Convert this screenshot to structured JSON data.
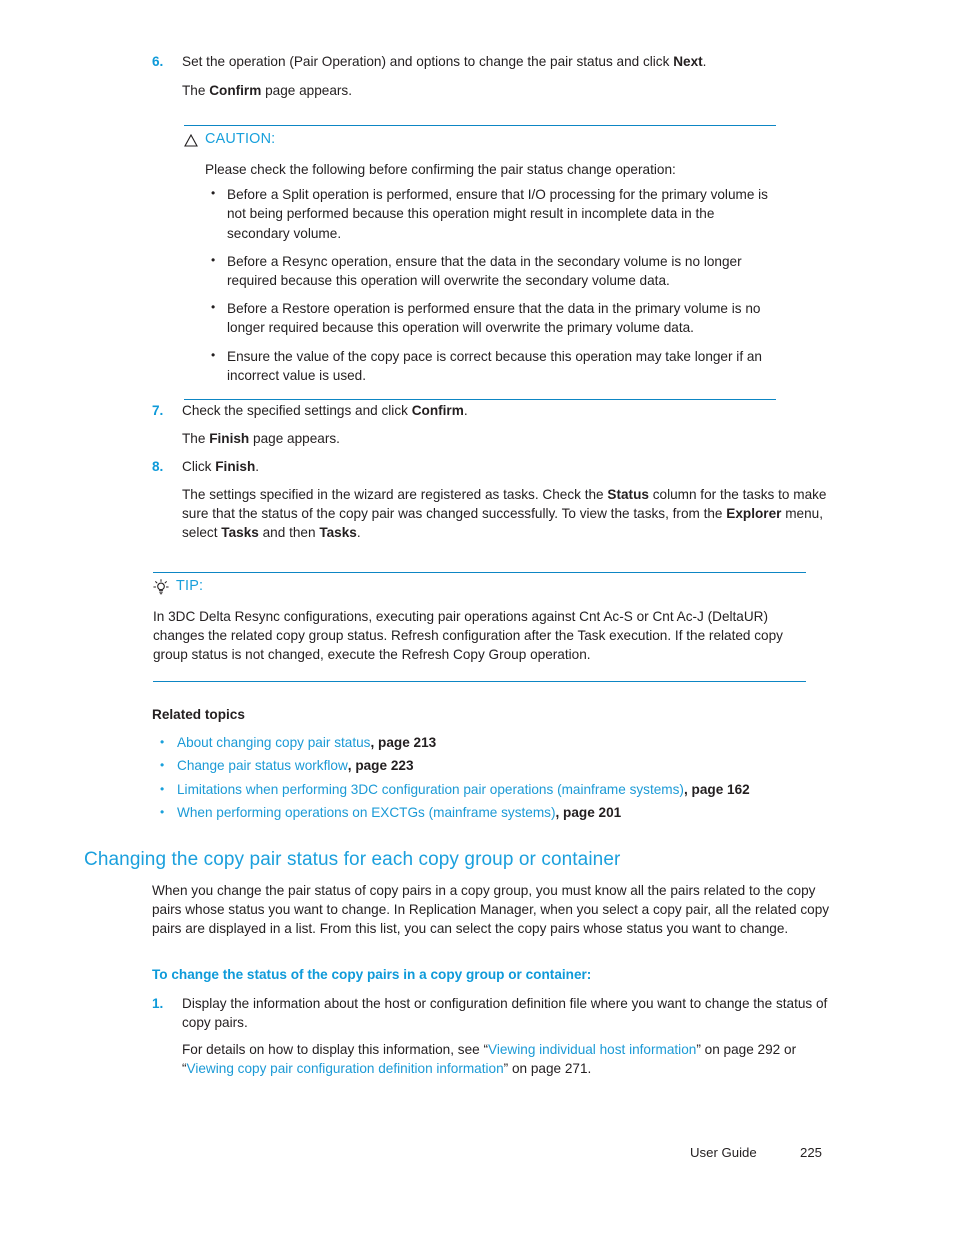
{
  "page": {
    "number": "225",
    "footer_label": "User Guide"
  },
  "colors": {
    "accent_blue": "#19a0db",
    "rule_blue": "#0d86c4",
    "link_blue": "#1b9ad6",
    "heading_blue": "#1ba0dd",
    "body_black": "#231f20"
  },
  "steps": {
    "step6": {
      "number": "6.",
      "text_pre": "Set the operation (Pair Operation) and options to change the pair status and click ",
      "bold1": "Next",
      "text_post": ".",
      "followup_pre": "The ",
      "followup_bold": "Confirm",
      "followup_post": " page appears."
    },
    "step7": {
      "number": "7.",
      "text_pre": "Check the specified settings and click ",
      "bold1": "Confirm",
      "text_post": ".",
      "followup_pre": "The ",
      "followup_bold": "Finish",
      "followup_post": " page appears."
    },
    "step8": {
      "number": "8.",
      "text_pre": "Click ",
      "bold1": "Finish",
      "text_post": ".",
      "para_1": "The settings specified in the wizard are registered as tasks. Check the ",
      "para_b1": "Status",
      "para_2": " column for the tasks to make sure that the status of the copy pair was changed successfully. To view the tasks, from the ",
      "para_b2": "Explorer",
      "para_3": " menu, select ",
      "para_b3": "Tasks",
      "para_4": " and then ",
      "para_b4": "Tasks",
      "para_5": "."
    }
  },
  "caution": {
    "icon": "warning-triangle-icon",
    "label": "CAUTION:",
    "intro": "Please check the following before confirming the pair status change operation:",
    "bullets": [
      "Before a Split operation is performed, ensure that I/O processing for the primary volume is not being performed because this operation might result in incomplete data in the secondary volume.",
      "Before a Resync operation, ensure that the data in the secondary volume is no longer required because this operation will overwrite the secondary volume data.",
      "Before a Restore operation is performed ensure that the data in the primary volume is no longer required because this operation will overwrite the primary volume data.",
      "Ensure the value of the copy pace is correct because this operation may take longer if an incorrect value is used."
    ]
  },
  "tip": {
    "icon": "lightbulb-icon",
    "label": "TIP:",
    "body": "In 3DC Delta Resync configurations, executing pair operations against Cnt Ac-S or Cnt Ac-J (DeltaUR) changes the related copy group status. Refresh configuration after the Task execution. If the related copy group status is not changed, execute the Refresh Copy Group operation."
  },
  "related_topics": {
    "heading": "Related topics",
    "items": [
      {
        "link": "About changing copy pair status",
        "page": ", page 213"
      },
      {
        "link": "Change pair status workflow",
        "page": ", page 223"
      },
      {
        "link": "Limitations when performing 3DC configuration pair operations (mainframe systems)",
        "page": ", page 162"
      },
      {
        "link": "When performing operations on EXCTGs (mainframe systems)",
        "page": ", page 201"
      }
    ]
  },
  "section": {
    "heading": "Changing the copy pair status for each copy group or container",
    "paragraph": "When you change the pair status of copy pairs in a copy group, you must know all the pairs related to the copy pairs whose status you want to change. In Replication Manager, when you select a copy pair, all the related copy pairs are displayed in a list. From this list, you can select the copy pairs whose status you want to change.",
    "subheading": "To change the status of the copy pairs in a copy group or container:",
    "step1": {
      "number": "1.",
      "text": "Display the information about the host or configuration definition file where you want to change the status of copy pairs.",
      "detail_pre": "For details on how to display this information, see “",
      "detail_link1": "Viewing individual host information",
      "detail_mid": "” on page 292 or “",
      "detail_link2": "Viewing copy pair configuration definition information",
      "detail_post": "” on page 271."
    }
  }
}
